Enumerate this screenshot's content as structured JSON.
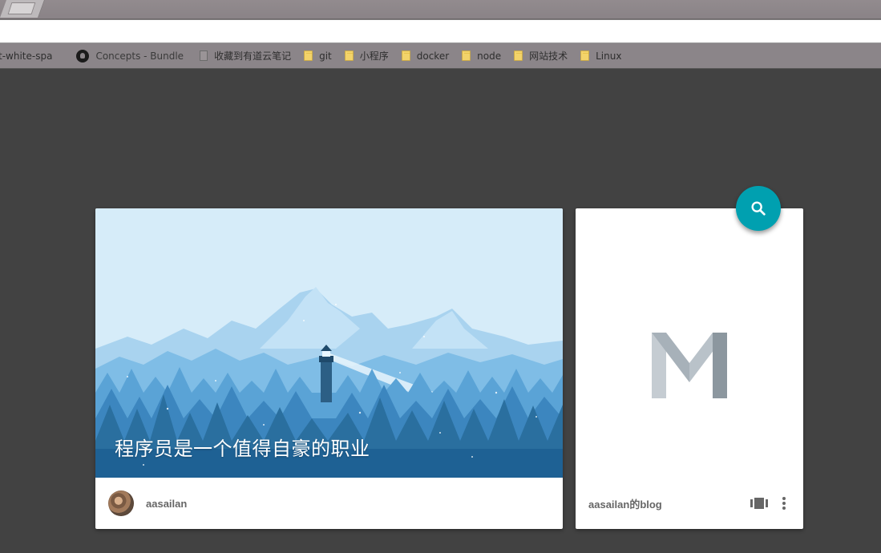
{
  "bookmarks": [
    {
      "label": "t-white-spa",
      "icon": "page-icon"
    },
    {
      "label": "Concepts - Bundle",
      "icon": "github-icon"
    },
    {
      "label": "收藏到有道云笔记",
      "icon": "page-icon"
    },
    {
      "label": "git",
      "icon": "folder-icon"
    },
    {
      "label": "小程序",
      "icon": "folder-icon"
    },
    {
      "label": "docker",
      "icon": "folder-icon"
    },
    {
      "label": "node",
      "icon": "folder-icon"
    },
    {
      "label": "网站技术",
      "icon": "folder-icon"
    },
    {
      "label": "Linux",
      "icon": "folder-icon"
    }
  ],
  "main_card": {
    "title": "程序员是一个值得自豪的职业",
    "author": "aasailan"
  },
  "side_card": {
    "blog_name": "aasailan的blog"
  },
  "colors": {
    "background": "#424242",
    "fab": "#00a0b0",
    "sky": "#d6ecf9",
    "forest_dark": "#1e6fa3"
  },
  "icons": {
    "fab": "search-icon",
    "view": "view-carousel-icon",
    "more": "more-vert-icon",
    "logo": "m-logo"
  }
}
